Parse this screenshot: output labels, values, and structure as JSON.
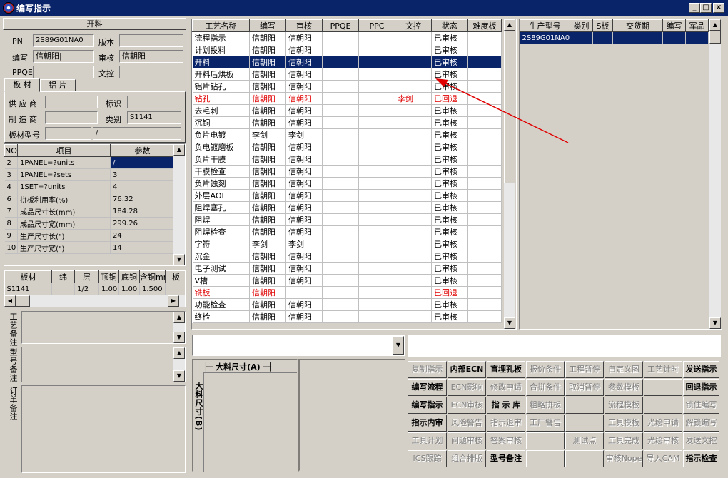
{
  "window": {
    "title": "编写指示",
    "min": "_",
    "max": "□",
    "close": "×"
  },
  "left": {
    "header": "开料",
    "pn_label": "PN",
    "pn_value": "2S89G01NA0",
    "version_label": "版本",
    "version_value": "",
    "writer_label": "编写",
    "writer_value": "信朝阳|",
    "review_label": "审核",
    "review_value": "信朝阳",
    "ppqe_label": "PPQE",
    "ppqe_value": "",
    "doc_label": "文控",
    "doc_value": "",
    "tab_board": "板 材",
    "tab_alu": "铝 片",
    "supplier_label": "供 应 商",
    "supplier_value": "",
    "mark_label": "标识",
    "mark_value": "",
    "maker_label": "制 造 商",
    "maker_value": "",
    "type_label": "类别",
    "type_value": "S1141",
    "model_label": "板材型号",
    "model_value": "",
    "model_value2": "/",
    "param_headers": [
      "NO",
      "项目",
      "参数"
    ],
    "params": [
      [
        "2",
        "1PANEL=?units",
        "/"
      ],
      [
        "3",
        "1PANEL=?sets",
        "3"
      ],
      [
        "4",
        "1SET=?units",
        "4"
      ],
      [
        "6",
        "拼板利用率(%)",
        "76.32"
      ],
      [
        "7",
        "成品尺寸长(mm)",
        "184.28"
      ],
      [
        "8",
        "成品尺寸宽(mm)",
        "299.26"
      ],
      [
        "9",
        "生产尺寸长(\")",
        "24"
      ],
      [
        "10",
        "生产尺寸宽(\")",
        "14"
      ]
    ],
    "mat_headers": [
      "板材",
      "纬",
      "层",
      "顶铜",
      "底铜",
      "含铜mm",
      "板"
    ],
    "mat_rows": [
      [
        "S1141",
        "",
        "1/2",
        "1.00",
        "1.00",
        "1.500",
        ""
      ]
    ],
    "notes": [
      {
        "label": "工艺备注"
      },
      {
        "label": "型号备注"
      },
      {
        "label": "订单备注"
      }
    ]
  },
  "process": {
    "headers": [
      "工艺名称",
      "编写",
      "审核",
      "PPQE",
      "PPC",
      "文控",
      "状态",
      "难度板"
    ],
    "rows": [
      [
        "流程指示",
        "信朝阳",
        "信朝阳",
        "",
        "",
        "",
        "已审核",
        ""
      ],
      [
        "计划投料",
        "信朝阳",
        "信朝阳",
        "",
        "",
        "",
        "已审核",
        ""
      ],
      [
        "开料",
        "信朝阳",
        "信朝阳",
        "",
        "",
        "",
        "已审核",
        ""
      ],
      [
        "开料后烘板",
        "信朝阳",
        "信朝阳",
        "",
        "",
        "",
        "已审核",
        ""
      ],
      [
        "铝片钻孔",
        "信朝阳",
        "信朝阳",
        "",
        "",
        "",
        "已审核",
        ""
      ],
      [
        "钻孔",
        "信朝阳",
        "信朝阳",
        "",
        "",
        "李剑",
        "已回退",
        ""
      ],
      [
        "去毛刺",
        "信朝阳",
        "信朝阳",
        "",
        "",
        "",
        "已审核",
        ""
      ],
      [
        "沉铜",
        "信朝阳",
        "信朝阳",
        "",
        "",
        "",
        "已审核",
        ""
      ],
      [
        "负片电镀",
        "李剑",
        "李剑",
        "",
        "",
        "",
        "已审核",
        ""
      ],
      [
        "负电镀磨板",
        "信朝阳",
        "信朝阳",
        "",
        "",
        "",
        "已审核",
        ""
      ],
      [
        "负片干膜",
        "信朝阳",
        "信朝阳",
        "",
        "",
        "",
        "已审核",
        ""
      ],
      [
        "干膜检查",
        "信朝阳",
        "信朝阳",
        "",
        "",
        "",
        "已审核",
        ""
      ],
      [
        "负片蚀刻",
        "信朝阳",
        "信朝阳",
        "",
        "",
        "",
        "已审核",
        ""
      ],
      [
        "外层AOI",
        "信朝阳",
        "信朝阳",
        "",
        "",
        "",
        "已审核",
        ""
      ],
      [
        "阻焊塞孔",
        "信朝阳",
        "信朝阳",
        "",
        "",
        "",
        "已审核",
        ""
      ],
      [
        "阻焊",
        "信朝阳",
        "信朝阳",
        "",
        "",
        "",
        "已审核",
        ""
      ],
      [
        "阻焊检查",
        "信朝阳",
        "信朝阳",
        "",
        "",
        "",
        "已审核",
        ""
      ],
      [
        "字符",
        "李剑",
        "李剑",
        "",
        "",
        "",
        "已审核",
        ""
      ],
      [
        "沉金",
        "信朝阳",
        "信朝阳",
        "",
        "",
        "",
        "已审核",
        ""
      ],
      [
        "电子测试",
        "信朝阳",
        "信朝阳",
        "",
        "",
        "",
        "已审核",
        ""
      ],
      [
        "V槽",
        "信朝阳",
        "信朝阳",
        "",
        "",
        "",
        "已审核",
        ""
      ],
      [
        "铣板",
        "信朝阳",
        "",
        "",
        "",
        "",
        "已回退",
        ""
      ],
      [
        "功能检查",
        "信朝阳",
        "信朝阳",
        "",
        "",
        "",
        "已审核",
        ""
      ],
      [
        "终检",
        "信朝阳",
        "信朝阳",
        "",
        "",
        "",
        "已审核",
        ""
      ]
    ],
    "selected_index": 2,
    "red_indices": [
      5,
      21
    ]
  },
  "right": {
    "headers": [
      "生产型号",
      "类别",
      "S板",
      "交货期",
      "编写",
      "军品"
    ],
    "rows": [
      [
        "2S89G01NA0",
        "",
        "",
        "",
        "",
        ""
      ]
    ]
  },
  "diagram": {
    "a_label": "大料尺寸(A)",
    "b_label": "大料尺寸(B)"
  },
  "buttons": [
    [
      "复制指示",
      "内部ECN",
      "盲埋孔板",
      "报价条件",
      "工程暂停",
      "自定义图",
      "工艺计时",
      "发送指示"
    ],
    [
      "编写流程",
      "ECN影响",
      "修改申请",
      "合拼条件",
      "取消暂停",
      "参数模板",
      "",
      "回退指示"
    ],
    [
      "编写指示",
      "ECN审核",
      "指 示 库",
      "粗略拼板",
      "",
      "流程模板",
      "",
      "锁住编写"
    ],
    [
      "指示内审",
      "风险警告",
      "指示退审",
      "工厂警告",
      "",
      "工具模板",
      "光绘申请",
      "解锁编写"
    ],
    [
      "工具计划",
      "问题审核",
      "答案审核",
      "",
      "测试点",
      "工具完成",
      "光绘审核",
      "发送文控"
    ],
    [
      "ICS跟踪",
      "组合排版",
      "型号备注",
      "",
      "",
      "审核Nope",
      "导入CAM",
      "指示检查"
    ]
  ],
  "button_enabled": [
    [
      false,
      true,
      true,
      false,
      false,
      false,
      false,
      true
    ],
    [
      true,
      false,
      false,
      false,
      false,
      false,
      false,
      true
    ],
    [
      true,
      false,
      true,
      false,
      false,
      false,
      false,
      false
    ],
    [
      true,
      false,
      false,
      false,
      false,
      false,
      false,
      false
    ],
    [
      false,
      false,
      false,
      false,
      false,
      false,
      false,
      false
    ],
    [
      false,
      false,
      true,
      false,
      false,
      false,
      false,
      true
    ]
  ],
  "colors": {
    "title_bg": "#0a246a",
    "selection": "#0a246a",
    "returned": "#e00000",
    "arrow": "#e00000"
  }
}
